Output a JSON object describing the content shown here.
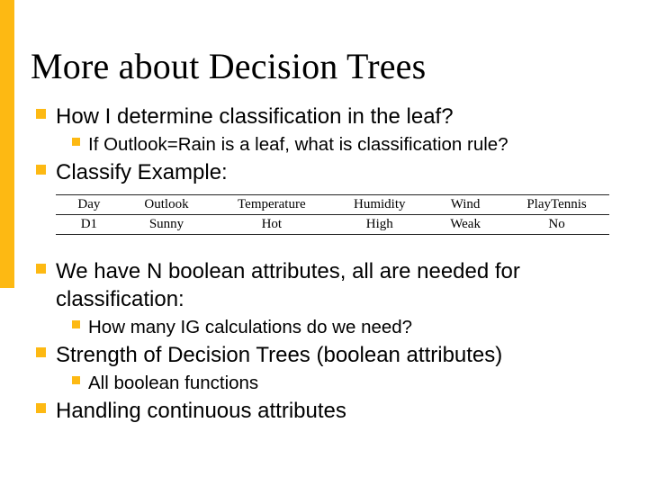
{
  "title": "More about Decision Trees",
  "bullets": {
    "b1": "How I determine classification in the leaf?",
    "b1a": "If Outlook=Rain is a leaf, what is classification rule?",
    "b2": "Classify Example:",
    "b3": "We have N boolean attributes, all are needed for classification:",
    "b3a": "How many IG calculations do we need?",
    "b4": "Strength of Decision Trees (boolean attributes)",
    "b4a": "All boolean functions",
    "b5": "Handling continuous attributes"
  },
  "table": {
    "headers": [
      "Day",
      "Outlook",
      "Temperature",
      "Humidity",
      "Wind",
      "PlayTennis"
    ],
    "row": [
      "D1",
      "Sunny",
      "Hot",
      "High",
      "Weak",
      "No"
    ]
  },
  "chart_data": {
    "type": "table",
    "title": "Classify Example",
    "columns": [
      "Day",
      "Outlook",
      "Temperature",
      "Humidity",
      "Wind",
      "PlayTennis"
    ],
    "rows": [
      {
        "Day": "D1",
        "Outlook": "Sunny",
        "Temperature": "Hot",
        "Humidity": "High",
        "Wind": "Weak",
        "PlayTennis": "No"
      }
    ]
  }
}
